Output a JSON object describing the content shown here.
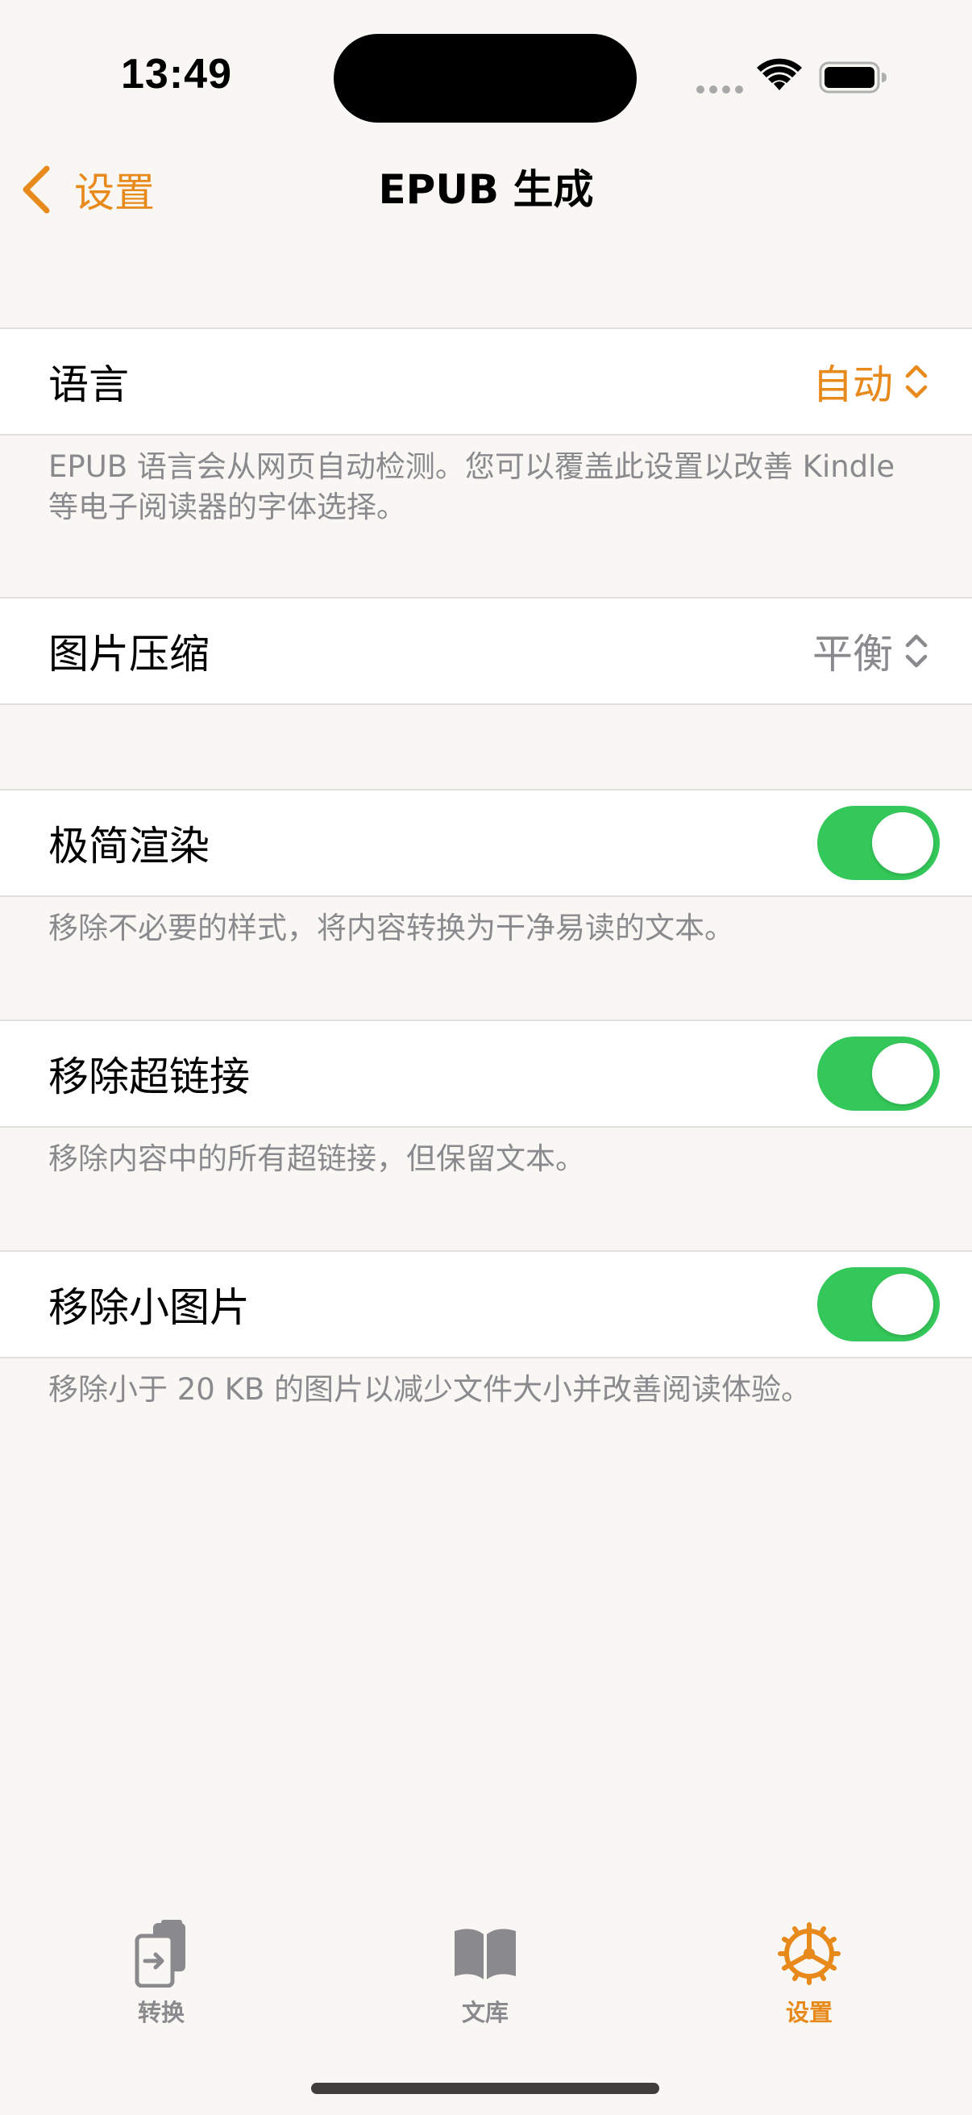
{
  "status_bar": {
    "time": "13:49"
  },
  "nav": {
    "back_label": "设置",
    "title": "EPUB 生成"
  },
  "settings": {
    "language": {
      "label": "语言",
      "value": "自动",
      "footnote": "EPUB 语言会从网页自动检测。您可以覆盖此设置以改善 Kindle 等电子阅读器的字体选择。"
    },
    "image_compression": {
      "label": "图片压缩",
      "value": "平衡"
    },
    "minimal_render": {
      "label": "极简渲染",
      "enabled": true,
      "footnote": "移除不必要的样式，将内容转换为干净易读的文本。"
    },
    "remove_links": {
      "label": "移除超链接",
      "enabled": true,
      "footnote": "移除内容中的所有超链接，但保留文本。"
    },
    "remove_small_images": {
      "label": "移除小图片",
      "enabled": true,
      "footnote": "移除小于 20 KB 的图片以减少文件大小并改善阅读体验。"
    }
  },
  "tab_bar": {
    "tabs": [
      {
        "label": "转换",
        "icon": "convert-icon",
        "active": false
      },
      {
        "label": "文库",
        "icon": "book-icon",
        "active": false
      },
      {
        "label": "设置",
        "icon": "gear-icon",
        "active": true
      }
    ]
  },
  "colors": {
    "accent": "#e8891c",
    "toggle_on": "#34c759",
    "secondary_text": "#8a8a8e",
    "background": "#f9f7f3"
  }
}
